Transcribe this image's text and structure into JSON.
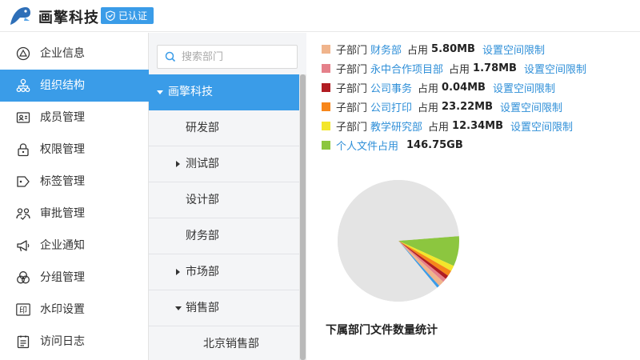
{
  "header": {
    "brand": "画擎科技",
    "verified_label": "已认证"
  },
  "sidebar": {
    "items": [
      {
        "label": "企业信息",
        "icon": "enterprise-icon"
      },
      {
        "label": "组织结构",
        "icon": "org-structure-icon",
        "active": true
      },
      {
        "label": "成员管理",
        "icon": "member-card-icon"
      },
      {
        "label": "权限管理",
        "icon": "lock-icon"
      },
      {
        "label": "标签管理",
        "icon": "tag-icon"
      },
      {
        "label": "审批管理",
        "icon": "approval-icon"
      },
      {
        "label": "企业通知",
        "icon": "megaphone-icon"
      },
      {
        "label": "分组管理",
        "icon": "group-icon"
      },
      {
        "label": "水印设置",
        "icon": "watermark-icon",
        "glyph": "印"
      },
      {
        "label": "访问日志",
        "icon": "log-icon"
      }
    ]
  },
  "tree": {
    "search_placeholder": "搜索部门",
    "items": [
      {
        "label": "画擎科技",
        "level": 0,
        "expanded": true,
        "selected": true
      },
      {
        "label": "研发部",
        "level": 1
      },
      {
        "label": "测试部",
        "level": 1,
        "collapsed": true
      },
      {
        "label": "设计部",
        "level": 1
      },
      {
        "label": "财务部",
        "level": 1
      },
      {
        "label": "市场部",
        "level": 1,
        "collapsed": true
      },
      {
        "label": "销售部",
        "level": 1,
        "expanded": true
      },
      {
        "label": "北京销售部",
        "level": 2
      }
    ]
  },
  "storage": {
    "legend": [
      {
        "prefix": "子部门",
        "name": "财务部",
        "usage_label": "占用",
        "size": "5.80MB",
        "limit_label": "设置空间限制",
        "color": "#f0b48c"
      },
      {
        "prefix": "子部门",
        "name": "永中合作项目部",
        "usage_label": "占用",
        "size": "1.78MB",
        "limit_label": "设置空间限制",
        "color": "#e5808a"
      },
      {
        "prefix": "子部门",
        "name": "公司事务",
        "usage_label": "占用",
        "size": "0.04MB",
        "limit_label": "设置空间限制",
        "color": "#b11c22"
      },
      {
        "prefix": "子部门",
        "name": "公司打印",
        "usage_label": "占用",
        "size": "23.22MB",
        "limit_label": "设置空间限制",
        "color": "#f7861b"
      },
      {
        "prefix": "子部门",
        "name": "教学研究部",
        "usage_label": "占用",
        "size": "12.34MB",
        "limit_label": "设置空间限制",
        "color": "#f3e62b"
      },
      {
        "prefix": "",
        "name": "个人文件占用",
        "usage_label": "",
        "size": "146.75GB",
        "limit_label": "",
        "color": "#8cc63f"
      }
    ],
    "section_title": "下属部门文件数量统计"
  },
  "chart_data": {
    "type": "pie",
    "title": "",
    "background_color": "#e4e4e4",
    "slices": [
      {
        "name": "个人文件占用",
        "value": 8,
        "color": "#8cc63f"
      },
      {
        "name": "教学研究部",
        "value": 1.5,
        "color": "#f3e62b"
      },
      {
        "name": "公司打印",
        "value": 1.5,
        "color": "#f7861b"
      },
      {
        "name": "公司事务",
        "value": 1,
        "color": "#b11c22"
      },
      {
        "name": "永中合作项目部",
        "value": 1,
        "color": "#e5808a"
      },
      {
        "name": "财务部",
        "value": 1.5,
        "color": "#f0b48c"
      },
      {
        "name": "其他",
        "value": 0.7,
        "color": "#3a9ce8"
      },
      {
        "name": "剩余",
        "value": 84.8,
        "color": "#e4e4e4"
      }
    ]
  }
}
